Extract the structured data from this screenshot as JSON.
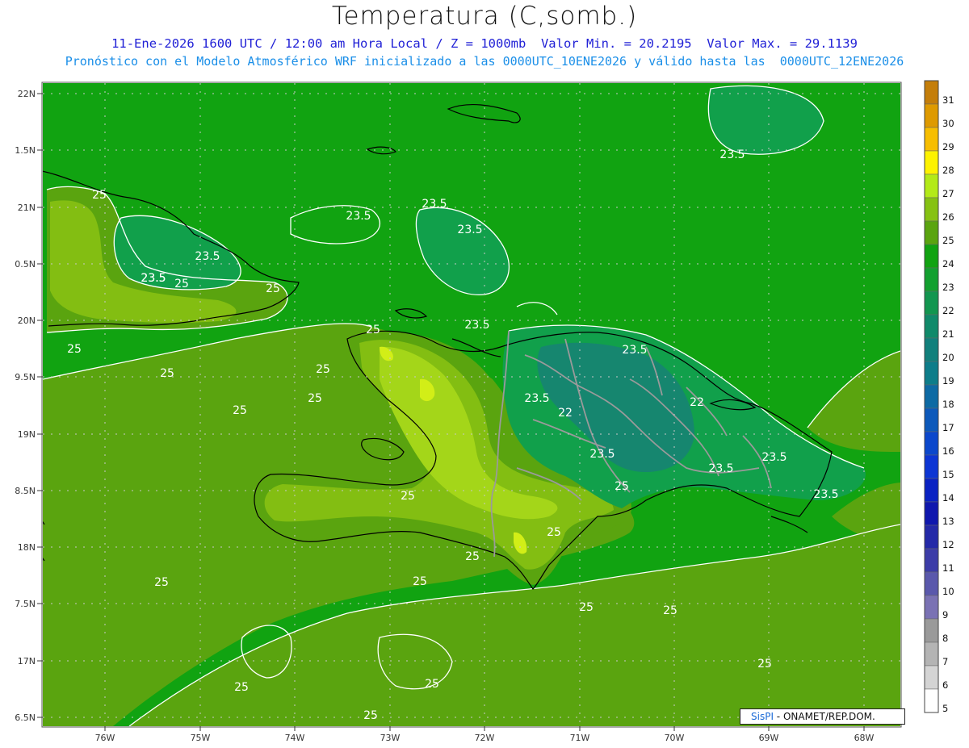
{
  "title": "Temperatura (C,somb.)",
  "subtitle": "11-Ene-2026 1600 UTC / 12:00 am Hora Local / Z = 1000mb  Valor Min. = 20.2195  Valor Max. = 29.1139",
  "subtitle2": "Pronóstico con el Modelo Atmosférico WRF inicializado a las 0000UTC_10ENE2026 y válido hasta las  0000UTC_12ENE2026",
  "colors": {
    "field_24": "#11a311",
    "field_25": "#5aa40f",
    "field_26": "#83be12",
    "field_27": "#a4d619",
    "field_28": "#d2ee17",
    "field_23": "#11a04b",
    "field_22": "#16866f",
    "coast": "#000000",
    "border": "#9a9a9a",
    "contour": "#ffffff"
  },
  "lat_labels": [
    "22N",
    "1.5N",
    "21N",
    "0.5N",
    "20N",
    "9.5N",
    "19N",
    "8.5N",
    "18N",
    "7.5N",
    "17N",
    "6.5N"
  ],
  "lon_labels": [
    "76W",
    "75W",
    "74W",
    "73W",
    "72W",
    "71W",
    "70W",
    "69W",
    "68W"
  ],
  "colorbar": {
    "labels": [
      "31",
      "30",
      "29",
      "28",
      "27",
      "26",
      "25",
      "24",
      "23",
      "22",
      "21",
      "20",
      "19",
      "18",
      "17",
      "16",
      "15",
      "14",
      "13",
      "12",
      "11",
      "10",
      "9",
      "8",
      "7",
      "6",
      "5"
    ],
    "colors": [
      "#c47e0a",
      "#de9a00",
      "#f7be00",
      "#fdf200",
      "#b3ea18",
      "#86c212",
      "#5aa40f",
      "#11a311",
      "#12a02f",
      "#129650",
      "#108a6a",
      "#11807c",
      "#0d7d8a",
      "#0d6aa4",
      "#0c59bb",
      "#0b47cc",
      "#0c35d4",
      "#0a22c3",
      "#0f17ae",
      "#2429a8",
      "#3c3ca8",
      "#5a58ac",
      "#7a72b4",
      "#9a9a9a",
      "#b4b4b4",
      "#d4d4d4",
      "#ffffff"
    ]
  },
  "contour_labels": [
    {
      "text": "23.5"
    },
    {
      "text": "23.5"
    },
    {
      "text": "23.5"
    },
    {
      "text": "23.5"
    },
    {
      "text": "23.5"
    },
    {
      "text": "23.5"
    },
    {
      "text": "23.5"
    },
    {
      "text": "23.5"
    },
    {
      "text": "23.5"
    },
    {
      "text": "23.5"
    },
    {
      "text": "23.5"
    },
    {
      "text": "23.5"
    },
    {
      "text": "23.5"
    },
    {
      "text": "23.5"
    },
    {
      "text": "25"
    },
    {
      "text": "25"
    },
    {
      "text": "25"
    },
    {
      "text": "25"
    },
    {
      "text": "25"
    },
    {
      "text": "25"
    },
    {
      "text": "25"
    },
    {
      "text": "25"
    },
    {
      "text": "25"
    },
    {
      "text": "25"
    },
    {
      "text": "25"
    },
    {
      "text": "25"
    },
    {
      "text": "25"
    },
    {
      "text": "25"
    },
    {
      "text": "25"
    },
    {
      "text": "25"
    },
    {
      "text": "25"
    },
    {
      "text": "25"
    },
    {
      "text": "25"
    },
    {
      "text": "25"
    },
    {
      "text": "25"
    },
    {
      "text": "22"
    },
    {
      "text": "22"
    }
  ],
  "credit": {
    "brand": "SisPI",
    "text": " - ONAMET/REP.DOM."
  }
}
